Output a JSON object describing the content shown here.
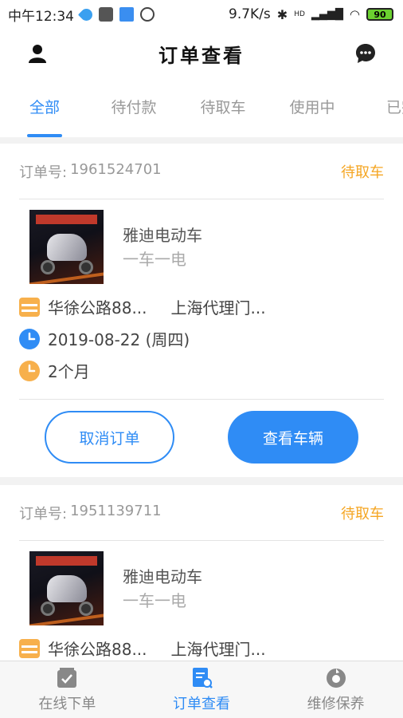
{
  "status_bar": {
    "time": "中午12:34",
    "network_speed": "9.7K/s",
    "signal_label": "HD",
    "battery": "90"
  },
  "header": {
    "title": "订单查看"
  },
  "tabs": [
    {
      "label": "全部",
      "active": true
    },
    {
      "label": "待付款",
      "active": false
    },
    {
      "label": "待取车",
      "active": false
    },
    {
      "label": "使用中",
      "active": false
    },
    {
      "label": "已完",
      "active": false
    }
  ],
  "orders": [
    {
      "order_label": "订单号:",
      "order_no": "1961524701",
      "status": "待取车",
      "product_name": "雅迪电动车",
      "product_desc": "一车一电",
      "address": "华徐公路88...",
      "shop": "上海代理门...",
      "date": "2019-08-22 (周四)",
      "duration": "2个月",
      "cancel_label": "取消订单",
      "view_label": "查看车辆"
    },
    {
      "order_label": "订单号:",
      "order_no": "1951139711",
      "status": "待取车",
      "product_name": "雅迪电动车",
      "product_desc": "一车一电",
      "address": "华徐公路88...",
      "shop": "上海代理门..."
    }
  ],
  "bottom_nav": [
    {
      "label": "在线下单",
      "icon": "checkbox-icon",
      "active": false
    },
    {
      "label": "订单查看",
      "icon": "document-search-icon",
      "active": true
    },
    {
      "label": "维修保养",
      "icon": "maintenance-icon",
      "active": false
    }
  ],
  "colors": {
    "accent": "#2f8cf5",
    "status": "#f5a623",
    "store_icon": "#f7b04c",
    "clock_icon": "#2f8cf5",
    "duration_icon": "#f7b04c"
  }
}
